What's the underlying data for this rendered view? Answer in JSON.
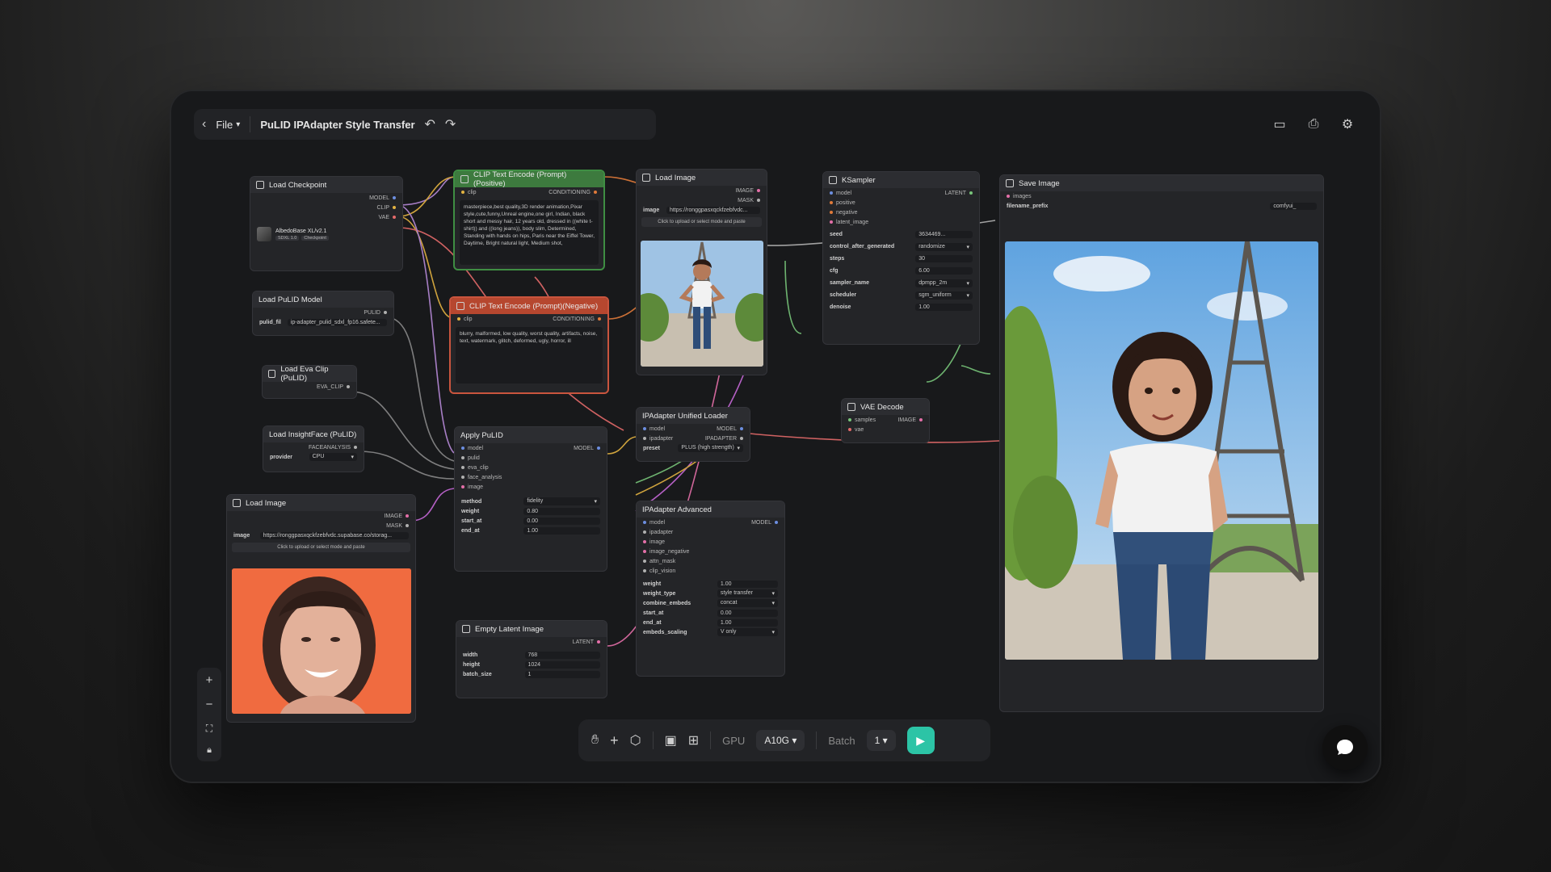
{
  "topbar": {
    "file_label": "File",
    "title": "PuLID IPAdapter Style Transfer"
  },
  "nodes": {
    "load_checkpoint": {
      "title": "Load Checkpoint",
      "outputs": [
        "MODEL",
        "CLIP",
        "VAE"
      ],
      "model_name": "AlbedoBase XL/v2.1",
      "tag1": "SDXL 1.0",
      "tag2": "Checkpoint"
    },
    "load_pulid_model": {
      "title": "Load PuLID Model",
      "output": "PULID",
      "widget_key": "pulid_fil",
      "widget_value": "ip-adapter_pulid_sdxl_fp16.safete..."
    },
    "load_eva_clip": {
      "title": "Load Eva Clip (PuLID)",
      "output": "EVA_CLIP"
    },
    "load_insightface": {
      "title": "Load InsightFace (PuLID)",
      "output": "FACEANALYSIS",
      "widget_key": "provider",
      "widget_value": "CPU"
    },
    "load_image_face": {
      "title": "Load Image",
      "outputs": [
        "IMAGE",
        "MASK"
      ],
      "widget_key": "image",
      "widget_value": "https://ronggpasxqckfzebfvdc.supabase.co/storag...",
      "upload": "Click to upload or select mode and paste"
    },
    "clip_positive": {
      "title": "CLIP Text Encode (Prompt)(Positive)",
      "input": "clip",
      "output": "CONDITIONING",
      "text": "masterpiece,best quality,3D render animation,Pixar style,cute,funny,Unreal engine,one girl, Indian, black short and messy hair, 12 years old, dressed in ((white t-shirt)) and ((long jeans)), body slim, Determined, Standing with hands on hips, Paris near the Eiffel Tower, Daytime, Bright natural light, Medium shot,"
    },
    "clip_negative": {
      "title": "CLIP Text Encode (Prompt)(Negative)",
      "input": "clip",
      "output": "CONDITIONING",
      "text": "blurry, malformed, low quality, worst quality, artifacts, noise, text, watermark, glitch, deformed, ugly, horror, ill"
    },
    "apply_pulid": {
      "title": "Apply PuLID",
      "inputs": [
        "model",
        "pulid",
        "eva_clip",
        "face_analysis",
        "image"
      ],
      "output": "MODEL",
      "widgets": [
        {
          "k": "method",
          "v": "fidelity"
        },
        {
          "k": "weight",
          "v": "0.80"
        },
        {
          "k": "start_at",
          "v": "0.00"
        },
        {
          "k": "end_at",
          "v": "1.00"
        }
      ]
    },
    "empty_latent": {
      "title": "Empty Latent Image",
      "output": "LATENT",
      "widgets": [
        {
          "k": "width",
          "v": "768"
        },
        {
          "k": "height",
          "v": "1024"
        },
        {
          "k": "batch_size",
          "v": "1"
        }
      ]
    },
    "load_image_ref": {
      "title": "Load Image",
      "outputs": [
        "IMAGE",
        "MASK"
      ],
      "widget_key": "image",
      "widget_value": "https://ronggpasxqckfzebfvdc...",
      "upload": "Click to upload or select mode and paste"
    },
    "ipadapter_loader": {
      "title": "IPAdapter Unified Loader",
      "inputs": [
        "model",
        "ipadapter"
      ],
      "outputs": [
        "MODEL",
        "IPADAPTER"
      ],
      "widget_key": "preset",
      "widget_value": "PLUS (high strength)"
    },
    "ipadapter_advanced": {
      "title": "IPAdapter Advanced",
      "inputs": [
        "model",
        "ipadapter",
        "image",
        "image_negative",
        "attn_mask",
        "clip_vision"
      ],
      "output": "MODEL",
      "widgets": [
        {
          "k": "weight",
          "v": "1.00"
        },
        {
          "k": "weight_type",
          "v": "style transfer"
        },
        {
          "k": "combine_embeds",
          "v": "concat"
        },
        {
          "k": "start_at",
          "v": "0.00"
        },
        {
          "k": "end_at",
          "v": "1.00"
        },
        {
          "k": "embeds_scaling",
          "v": "V only"
        }
      ]
    },
    "ksampler": {
      "title": "KSampler",
      "inputs": [
        "model",
        "positive",
        "negative",
        "latent_image"
      ],
      "output": "LATENT",
      "widgets": [
        {
          "k": "seed",
          "v": "3634469..."
        },
        {
          "k": "control_after_generated",
          "v": "randomize"
        },
        {
          "k": "steps",
          "v": "30"
        },
        {
          "k": "cfg",
          "v": "6.00"
        },
        {
          "k": "sampler_name",
          "v": "dpmpp_2m"
        },
        {
          "k": "scheduler",
          "v": "sgm_uniform"
        },
        {
          "k": "denoise",
          "v": "1.00"
        }
      ]
    },
    "vae_decode": {
      "title": "VAE Decode",
      "inputs": [
        "samples",
        "vae"
      ],
      "output": "IMAGE"
    },
    "save_image": {
      "title": "Save Image",
      "input": "images",
      "widget_key": "filename_prefix",
      "widget_value": "comfyui_"
    }
  },
  "toolbar": {
    "gpu_label": "GPU",
    "gpu_value": "A10G",
    "batch_label": "Batch",
    "batch_value": "1"
  },
  "colors": {
    "accent": "#2cc4a6",
    "positive": "#3d7a3e",
    "negative": "#b6472f"
  }
}
